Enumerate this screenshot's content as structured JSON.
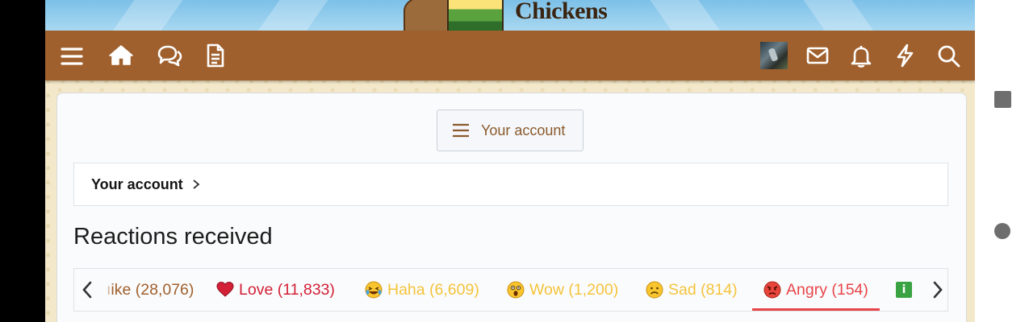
{
  "site": {
    "logo_text": "Chickens"
  },
  "nav": {
    "items": [
      {
        "icon": "menu-icon"
      },
      {
        "icon": "home-icon"
      },
      {
        "icon": "chat-bubbles-icon"
      },
      {
        "icon": "document-icon"
      },
      {
        "icon": "avatar"
      },
      {
        "icon": "mail-icon"
      },
      {
        "icon": "bell-icon"
      },
      {
        "icon": "lightning-icon"
      },
      {
        "icon": "search-icon"
      }
    ]
  },
  "account_menu": {
    "label": "Your account"
  },
  "breadcrumb": {
    "label": "Your account"
  },
  "page": {
    "title": "Reactions received"
  },
  "reaction_tabs": [
    {
      "clipped_prefix": "ı",
      "label": "ike (28,076)",
      "icon": "like-icon"
    },
    {
      "label": "Love (11,833)",
      "icon": "heart-emoji-icon"
    },
    {
      "label": "Haha (6,609)",
      "icon": "laughing-emoji-icon"
    },
    {
      "label": "Wow (1,200)",
      "icon": "wow-emoji-icon"
    },
    {
      "label": "Sad (814)",
      "icon": "sad-emoji-icon"
    },
    {
      "label": "Angry (154)",
      "icon": "angry-emoji-icon",
      "selected": true
    },
    {
      "label": "i",
      "icon": "info-icon"
    }
  ],
  "colors": {
    "navbar": "#a0602d",
    "accent_brown": "#8a5a2c",
    "love": "#d42037",
    "yellow_reaction": "#f5c33b",
    "angry": "#e8454a",
    "info_green": "#39a343"
  }
}
